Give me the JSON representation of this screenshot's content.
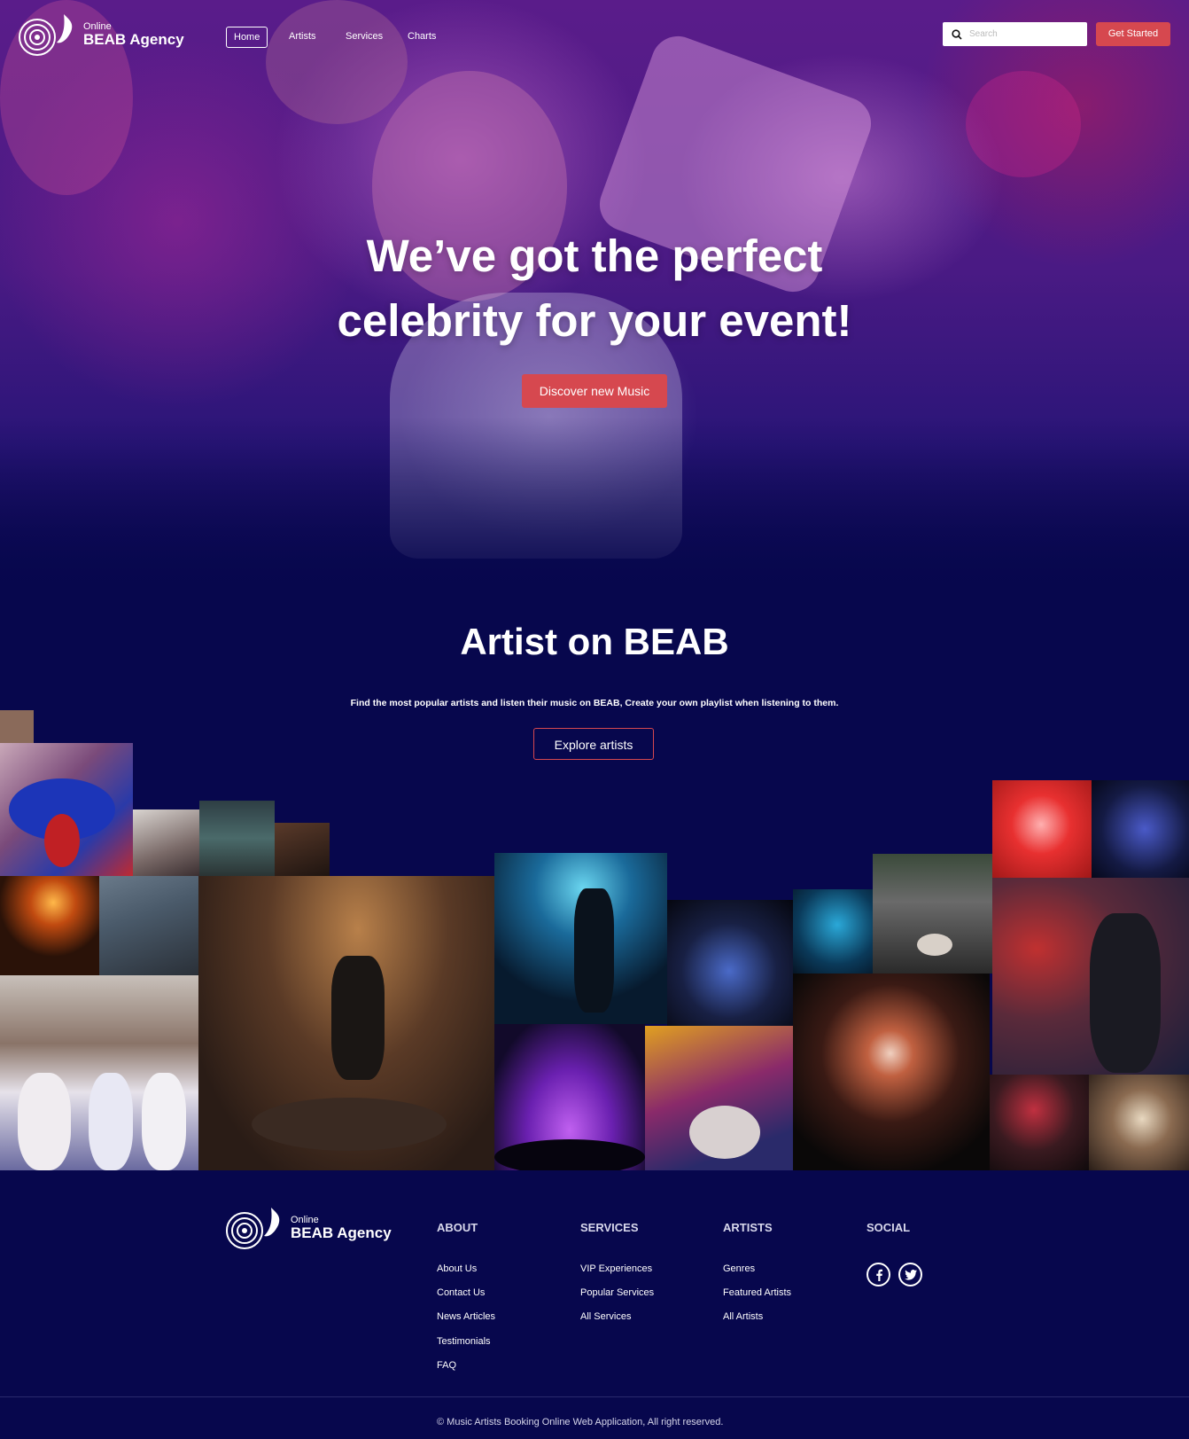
{
  "brand": {
    "small": "Online",
    "name": "BEAB Agency"
  },
  "nav": {
    "items": [
      {
        "label": "Home",
        "active": true
      },
      {
        "label": "Artists",
        "active": false
      },
      {
        "label": "Services",
        "active": false
      },
      {
        "label": "Charts",
        "active": false
      }
    ],
    "search_placeholder": "Search",
    "cta": "Get Started"
  },
  "hero": {
    "title_line1": "We’ve got the perfect",
    "title_line2": "celebrity for your event!",
    "button": "Discover new Music"
  },
  "artists_section": {
    "title": "Artist on BEAB",
    "subtitle": "Find the most popular artists and listen their music on BEAB, Create your own playlist when listening to them.",
    "button": "Explore artists"
  },
  "footer": {
    "about": {
      "title": "ABOUT",
      "links": [
        "About Us",
        "Contact Us",
        "News Articles",
        "Testimonials",
        "FAQ"
      ]
    },
    "services": {
      "title": "SERVICES",
      "links": [
        "VIP Experiences",
        "Popular Services",
        "All Services"
      ]
    },
    "artists": {
      "title": "ARTISTS",
      "links": [
        "Genres",
        "Featured Artists",
        "All Artists"
      ]
    },
    "social": {
      "title": "SOCIAL",
      "icons": [
        "facebook-icon",
        "twitter-icon"
      ]
    },
    "copyright": "© Music Artists Booking Online Web Application, All right reserved."
  },
  "colors": {
    "background": "#07074d",
    "accent": "#d6484f",
    "text": "#ffffff"
  }
}
